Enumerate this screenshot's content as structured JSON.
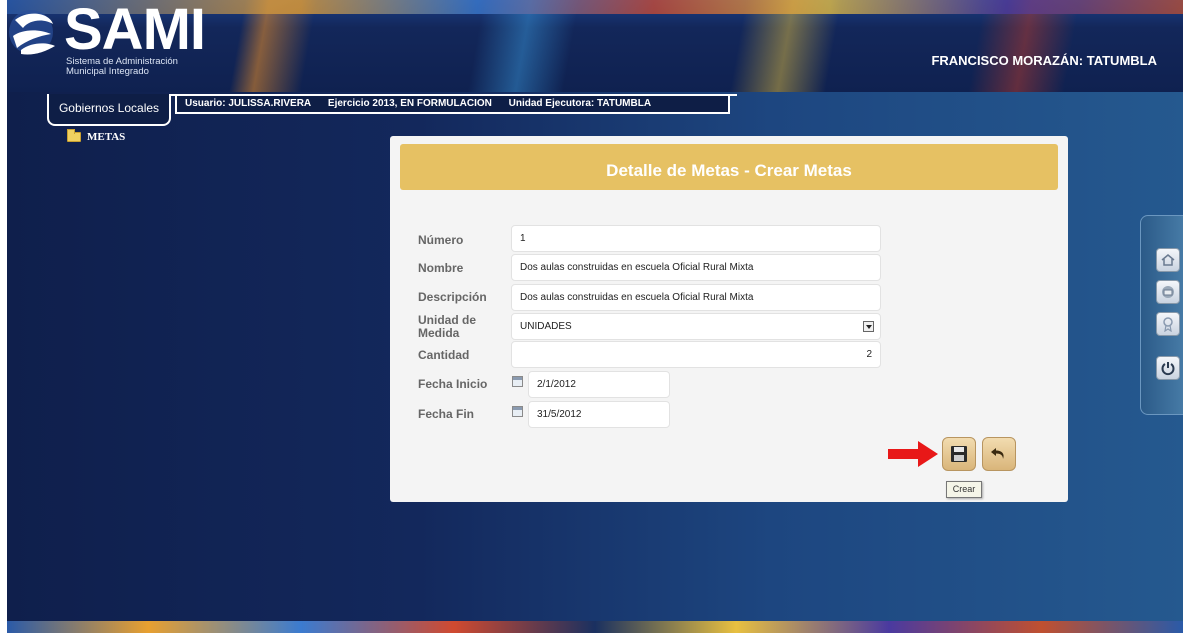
{
  "app": {
    "logo_text": "SAMI",
    "logo_subtitle_line1": "Sistema de Administración",
    "logo_subtitle_line2": "Municipal Integrado",
    "region": "FRANCISCO MORAZÁN: TATUMBLA"
  },
  "nav": {
    "tab_label": "Gobiernos Locales",
    "usuario": "Usuario: JULISSA.RIVERA",
    "ejercicio": "Ejercicio 2013, EN FORMULACION",
    "unidad": "Unidad Ejecutora: TATUMBLA"
  },
  "tree": {
    "metas_label": "METAS"
  },
  "form": {
    "title": "Detalle de Metas - Crear Metas",
    "numero_label": "Número",
    "numero_value": "1",
    "nombre_label": "Nombre",
    "nombre_value": "Dos aulas construidas en escuela Oficial Rural Mixta",
    "descripcion_label": "Descripción",
    "descripcion_value": "Dos aulas construidas en escuela Oficial Rural Mixta",
    "unidad_label_1": "Unidad de",
    "unidad_label_2": "Medida",
    "unidad_value": "UNIDADES",
    "cantidad_label": "Cantidad",
    "cantidad_value": "2",
    "fecha_inicio_label": "Fecha Inicio",
    "fecha_inicio_value": "2/1/2012",
    "fecha_fin_label": "Fecha Fin",
    "fecha_fin_value": "31/5/2012",
    "tooltip": "Crear"
  },
  "icons": {
    "save": "floppy-disk-icon",
    "back": "undo-arrow-icon",
    "pointer": "red-arrow-icon",
    "dock": [
      "home-icon",
      "inbox-icon",
      "award-icon",
      "power-icon"
    ]
  },
  "colors": {
    "header_gold": "#e6c163",
    "pointer_red": "#e81818",
    "navy": "#0e1e46"
  }
}
